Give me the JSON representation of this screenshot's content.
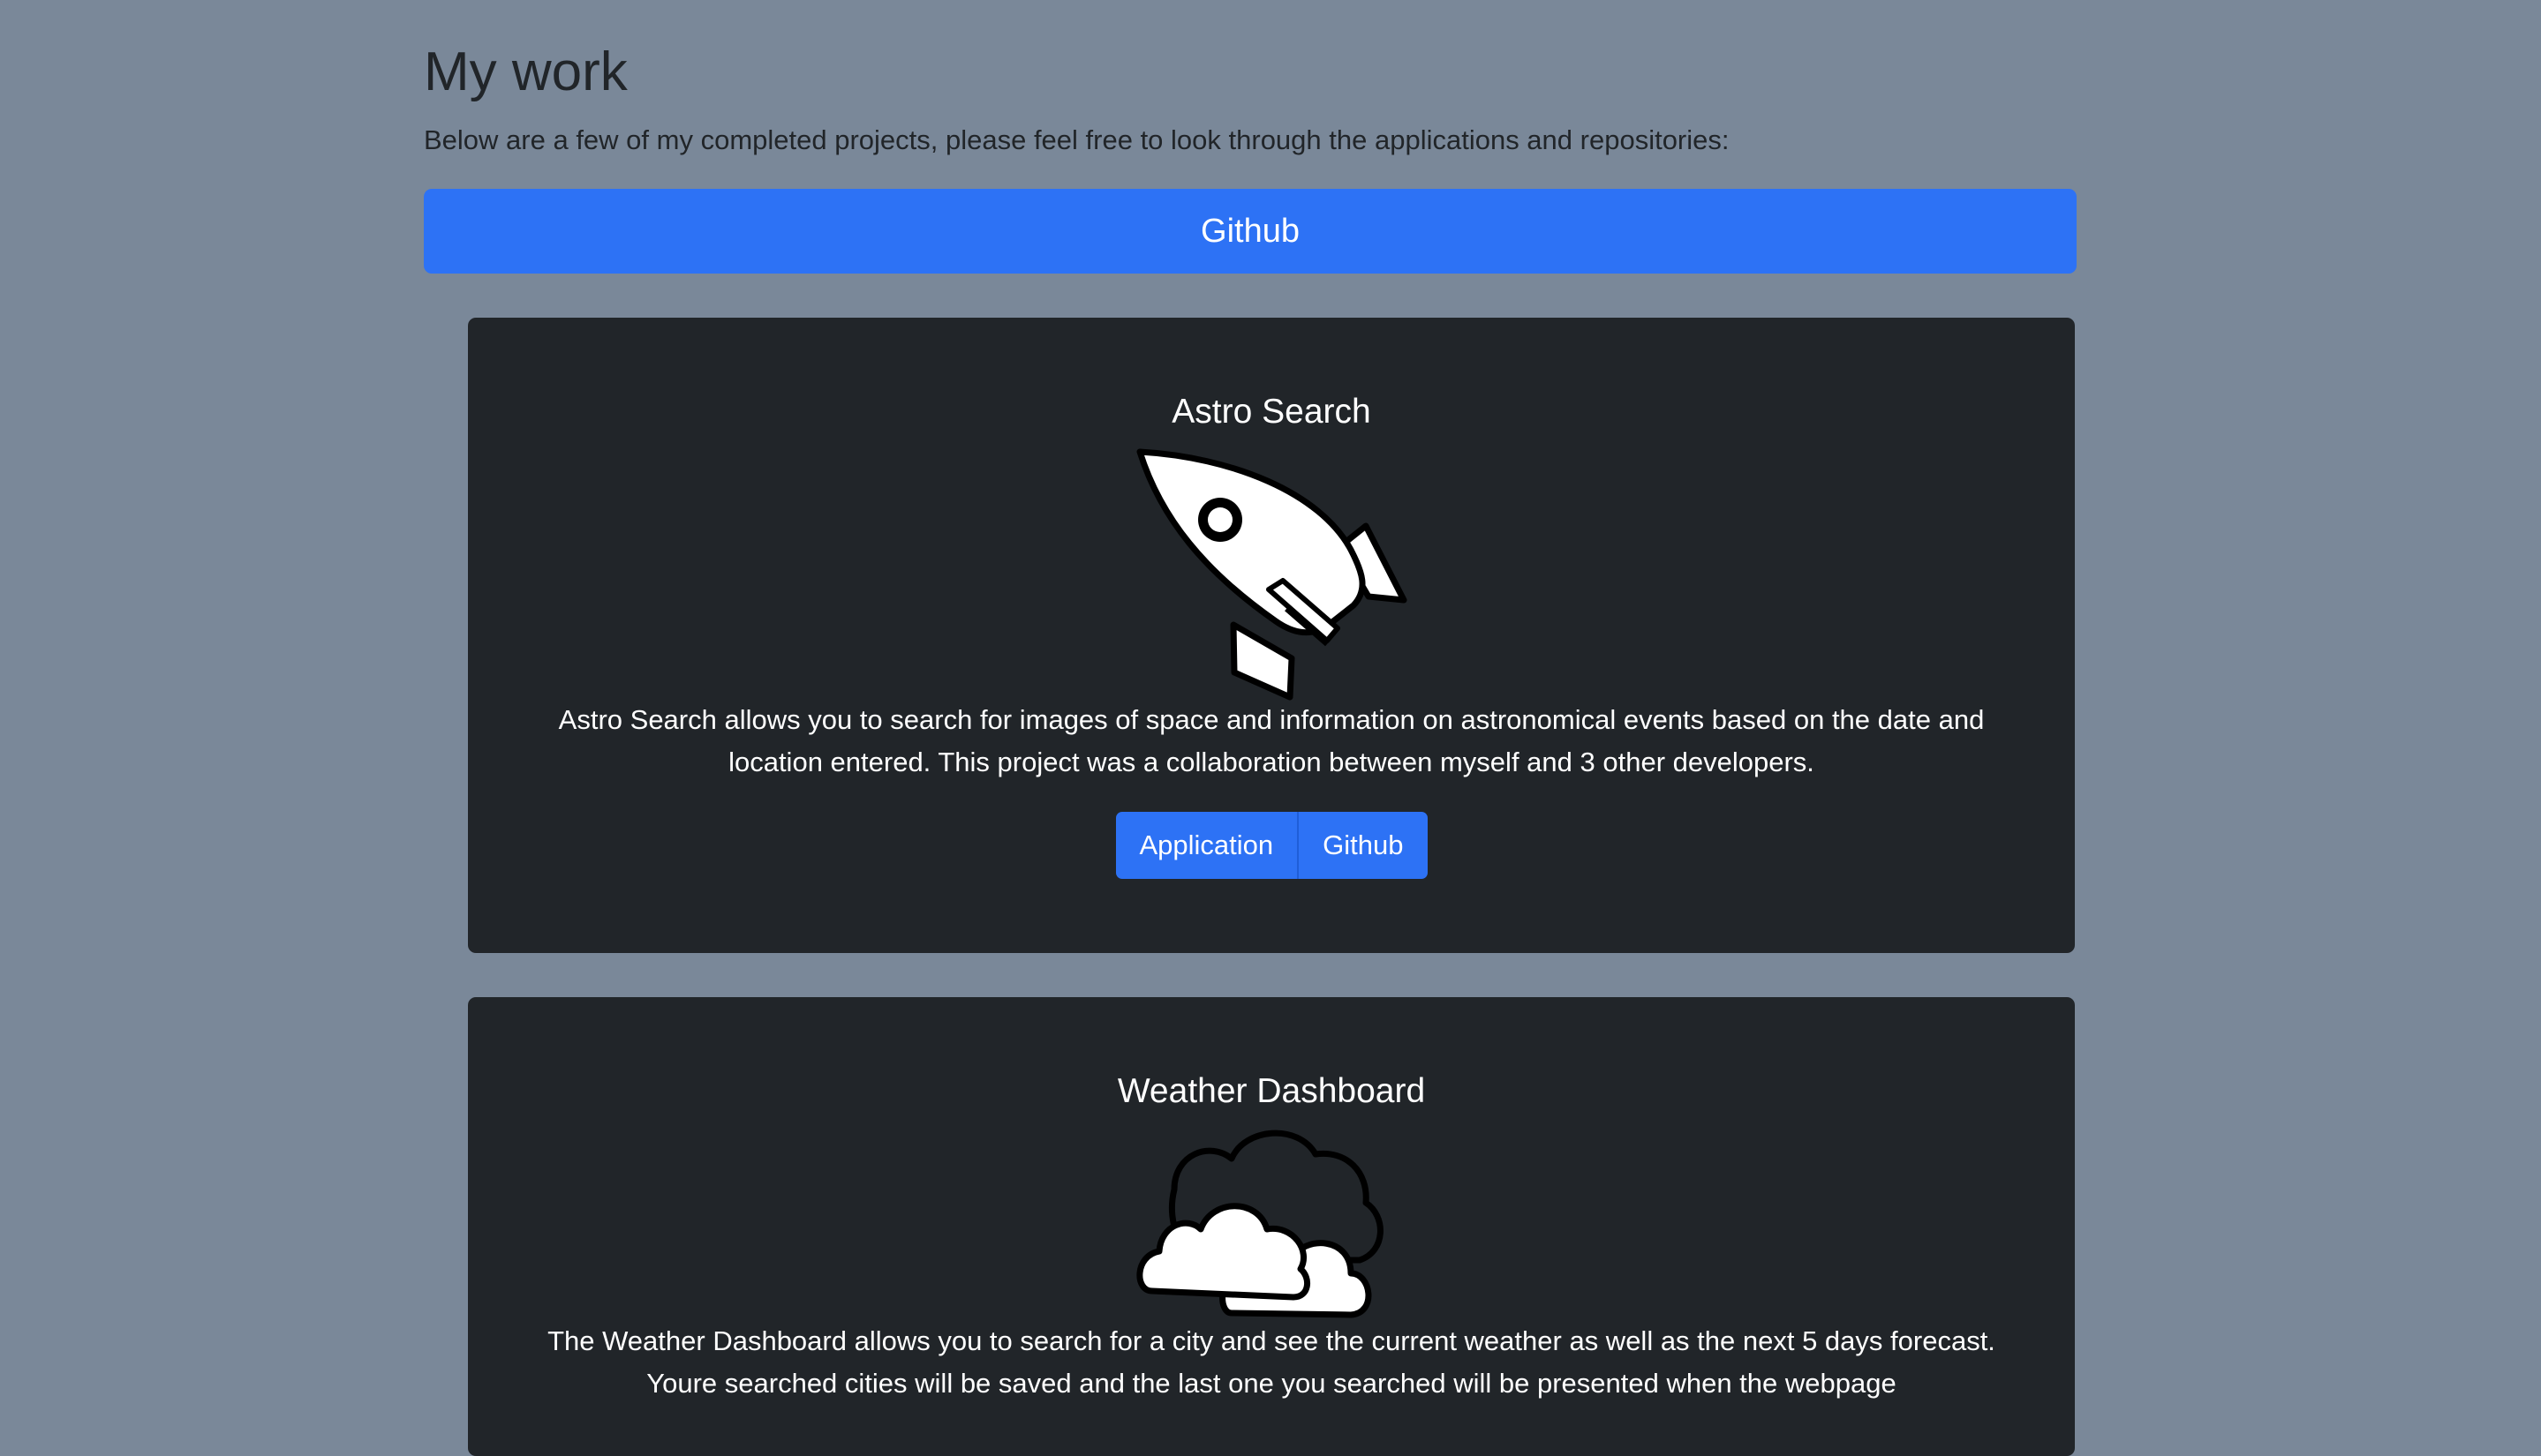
{
  "header": {
    "title": "My work",
    "intro": "Below are a few of my completed projects, please feel free to look through the applications and repositories:",
    "github_label": "Github"
  },
  "projects": [
    {
      "title": "Astro Search",
      "icon": "rocket-icon",
      "description": "Astro Search allows you to search for images of space and information on astronomical events based on the date and location entered. This project was a collaboration between myself and 3 other developers.",
      "application_label": "Application",
      "github_label": "Github"
    },
    {
      "title": "Weather Dashboard",
      "icon": "cloud-icon",
      "description": "The Weather Dashboard allows you to search for a city and see the current weather as well as the next 5 days forecast. Youre searched cities will be saved and the last one you searched will be presented when the webpage"
    }
  ],
  "colors": {
    "page_background": "#7a8899",
    "accent": "#2d72f5",
    "card_background": "#212529"
  }
}
